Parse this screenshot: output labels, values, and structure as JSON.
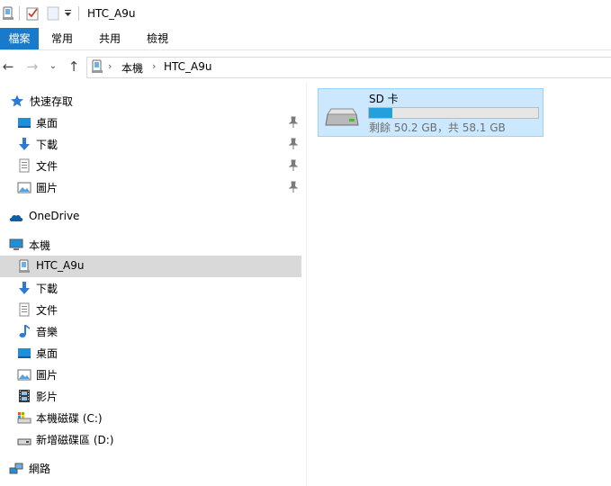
{
  "window": {
    "title": "HTC_A9u"
  },
  "ribbon": {
    "tabs": [
      "檔案",
      "常用",
      "共用",
      "檢視"
    ]
  },
  "address": {
    "segments": [
      "本機",
      "HTC_A9u"
    ]
  },
  "nav": {
    "quick_access": "快速存取",
    "quick_items": [
      "桌面",
      "下載",
      "文件",
      "圖片"
    ],
    "onedrive": "OneDrive",
    "this_pc": "本機",
    "pc_items": [
      "HTC_A9u",
      "下載",
      "文件",
      "音樂",
      "桌面",
      "圖片",
      "影片",
      "本機磁碟 (C:)",
      "新增磁碟區 (D:)"
    ],
    "network": "網路"
  },
  "drive": {
    "name": "SD 卡",
    "free_text": "剩餘 50.2 GB，共 58.1 GB",
    "used_fraction": 0.136
  },
  "colors": {
    "accent": "#1979ca",
    "selection": "#cce8ff",
    "bar": "#26a0da"
  }
}
